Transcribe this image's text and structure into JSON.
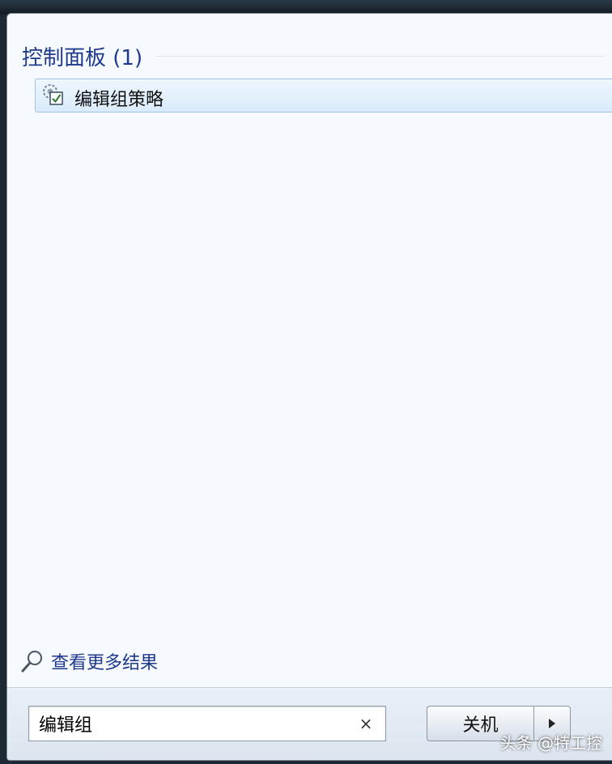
{
  "start_menu": {
    "group": {
      "title": "控制面板 (1)"
    },
    "results": [
      {
        "label": "编辑组策略",
        "icon": "group-policy-icon"
      }
    ],
    "see_more": {
      "label": "查看更多结果",
      "icon": "search-icon"
    },
    "search": {
      "value": "编辑组",
      "clear_symbol": "×"
    },
    "shutdown": {
      "label": "关机",
      "arrow_icon": "triangle-right-icon"
    }
  },
  "watermark": {
    "text": "头条 @特工控"
  },
  "colors": {
    "accent_text": "#1f3a8c",
    "highlight_bg": "#d9ebfb",
    "highlight_border": "#9ec3e6"
  }
}
